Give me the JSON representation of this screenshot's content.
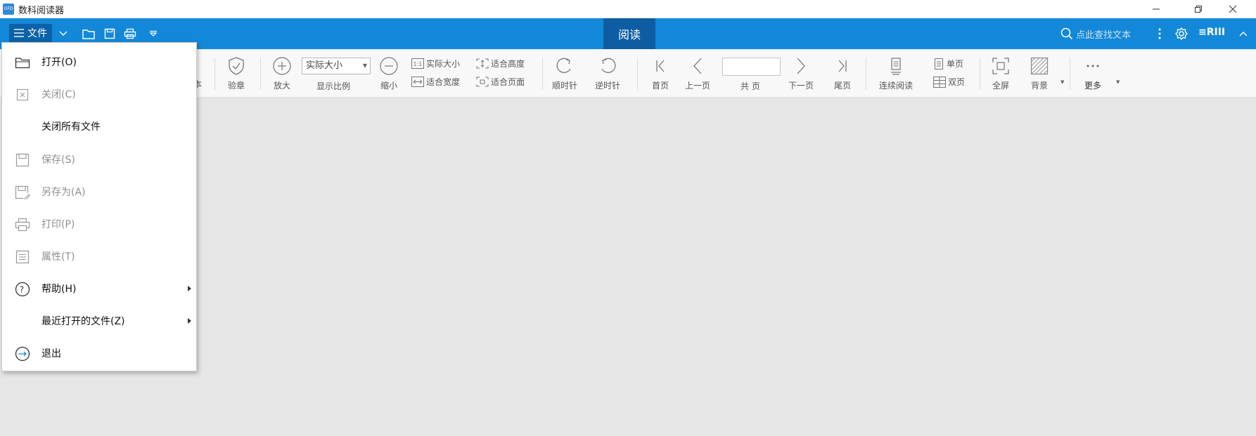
{
  "titlebar": {
    "title": "数科阅读器",
    "logo_text": "OFD"
  },
  "ribbon": {
    "file_label": "文件",
    "active_tab": "阅读",
    "search_placeholder": "点此查找文本",
    "user_label": "≡RIII"
  },
  "toolbar": {
    "stamp_partial": "本",
    "verify": "验章",
    "zoom_in": "放大",
    "zoom_select_value": "实际大小",
    "zoom_ratio": "显示比例",
    "zoom_out": "缩小",
    "actual_size": "实际大小",
    "fit_width": "适合宽度",
    "fit_height": "适合高度",
    "fit_page": "适合页面",
    "clockwise": "顺时针",
    "counterclockwise": "逆时针",
    "first_page": "首页",
    "prev_page": "上一页",
    "total_pages": "共 页",
    "next_page": "下一页",
    "last_page": "尾页",
    "continuous": "连续阅读",
    "single_page": "单页",
    "double_page": "双页",
    "fullscreen": "全屏",
    "background": "背景",
    "more": "更多"
  },
  "file_menu": [
    {
      "label": "打开(O)",
      "icon": "folder-open-icon",
      "enabled": true,
      "submenu": false
    },
    {
      "label": "关闭(C)",
      "icon": "close-icon",
      "enabled": false,
      "submenu": false
    },
    {
      "label": "关闭所有文件",
      "icon": "",
      "enabled": true,
      "submenu": false
    },
    {
      "label": "保存(S)",
      "icon": "save-icon",
      "enabled": false,
      "submenu": false
    },
    {
      "label": "另存为(A)",
      "icon": "save-as-icon",
      "enabled": false,
      "submenu": false
    },
    {
      "label": "打印(P)",
      "icon": "print-icon",
      "enabled": false,
      "submenu": false
    },
    {
      "label": "属性(T)",
      "icon": "properties-icon",
      "enabled": false,
      "submenu": false
    },
    {
      "label": "帮助(H)",
      "icon": "help-icon",
      "enabled": true,
      "submenu": true
    },
    {
      "label": "最近打开的文件(Z)",
      "icon": "",
      "enabled": true,
      "submenu": true
    },
    {
      "label": "退出",
      "icon": "exit-icon",
      "enabled": true,
      "submenu": false
    }
  ]
}
